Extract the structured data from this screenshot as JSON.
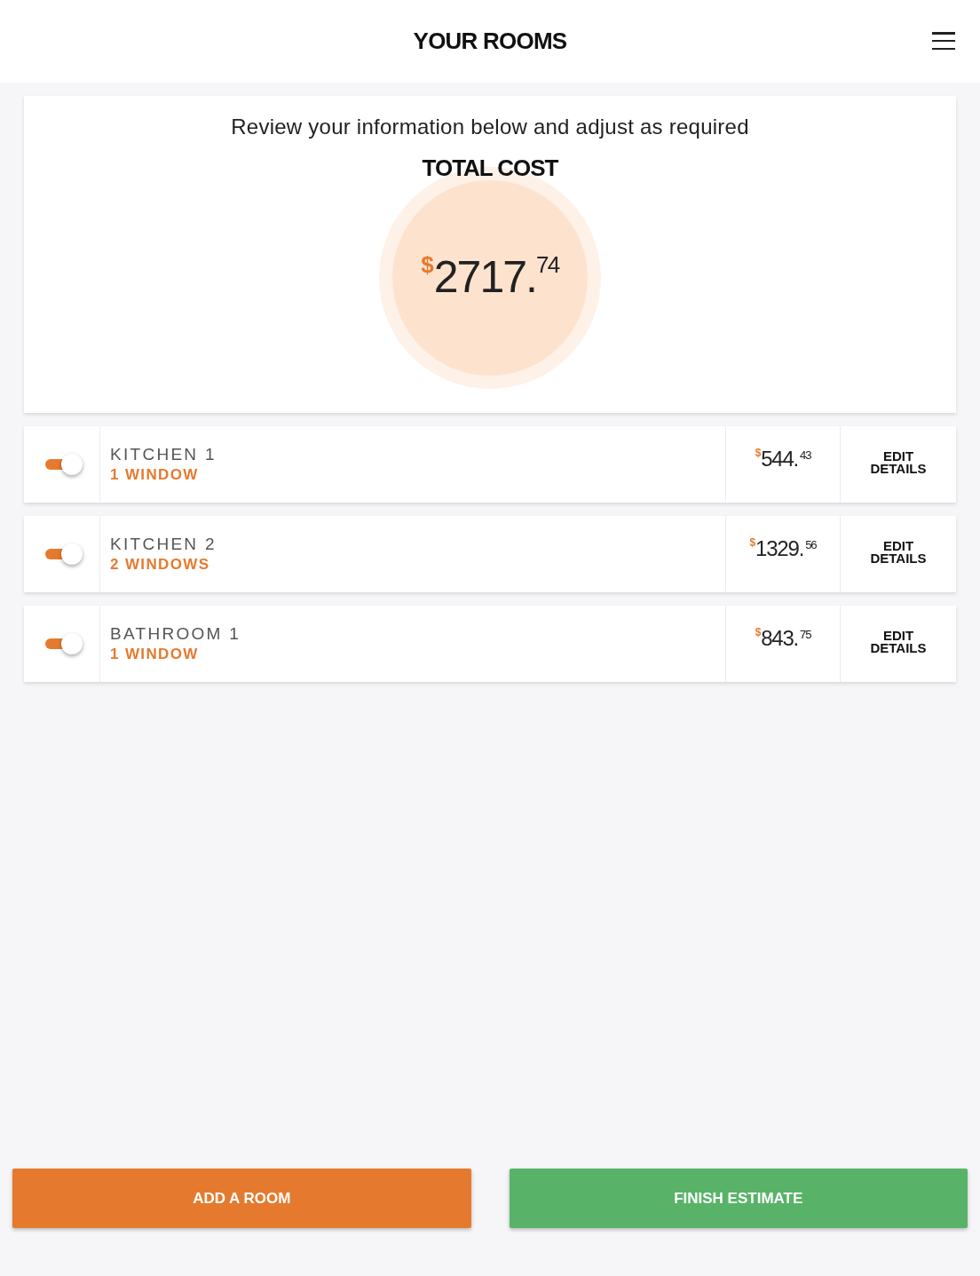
{
  "header": {
    "title": "YOUR ROOMS"
  },
  "summary": {
    "instruction": "Review your information below and adjust as required",
    "total_label": "TOTAL COST",
    "total": {
      "currency": "$",
      "amount": "2717.$^{74}$"
    }
  },
  "rooms": [
    {
      "name": "KITCHEN 1",
      "windows": "1 WINDOW",
      "on": true,
      "price": {
        "currency": "$",
        "amount": "544.$^{43}$"
      },
      "action": "EDIT DETAILS"
    },
    {
      "name": "KITCHEN 2",
      "windows": "2 WINDOWS",
      "on": true,
      "price": {
        "currency": "$",
        "amount": "1329.$^{56}$"
      },
      "action": "EDIT DETAILS"
    },
    {
      "name": "BATHROOM 1",
      "windows": "1 WINDOW",
      "on": true,
      "price": {
        "currency": "$",
        "amount": "843.$^{75}$"
      },
      "action": "EDIT DETAILS"
    }
  ],
  "buttons": [
    {
      "label": "ADD A ROOM",
      "kind": "primary"
    },
    {
      "label": "FINISH ESTIMATE",
      "kind": "success"
    }
  ]
}
